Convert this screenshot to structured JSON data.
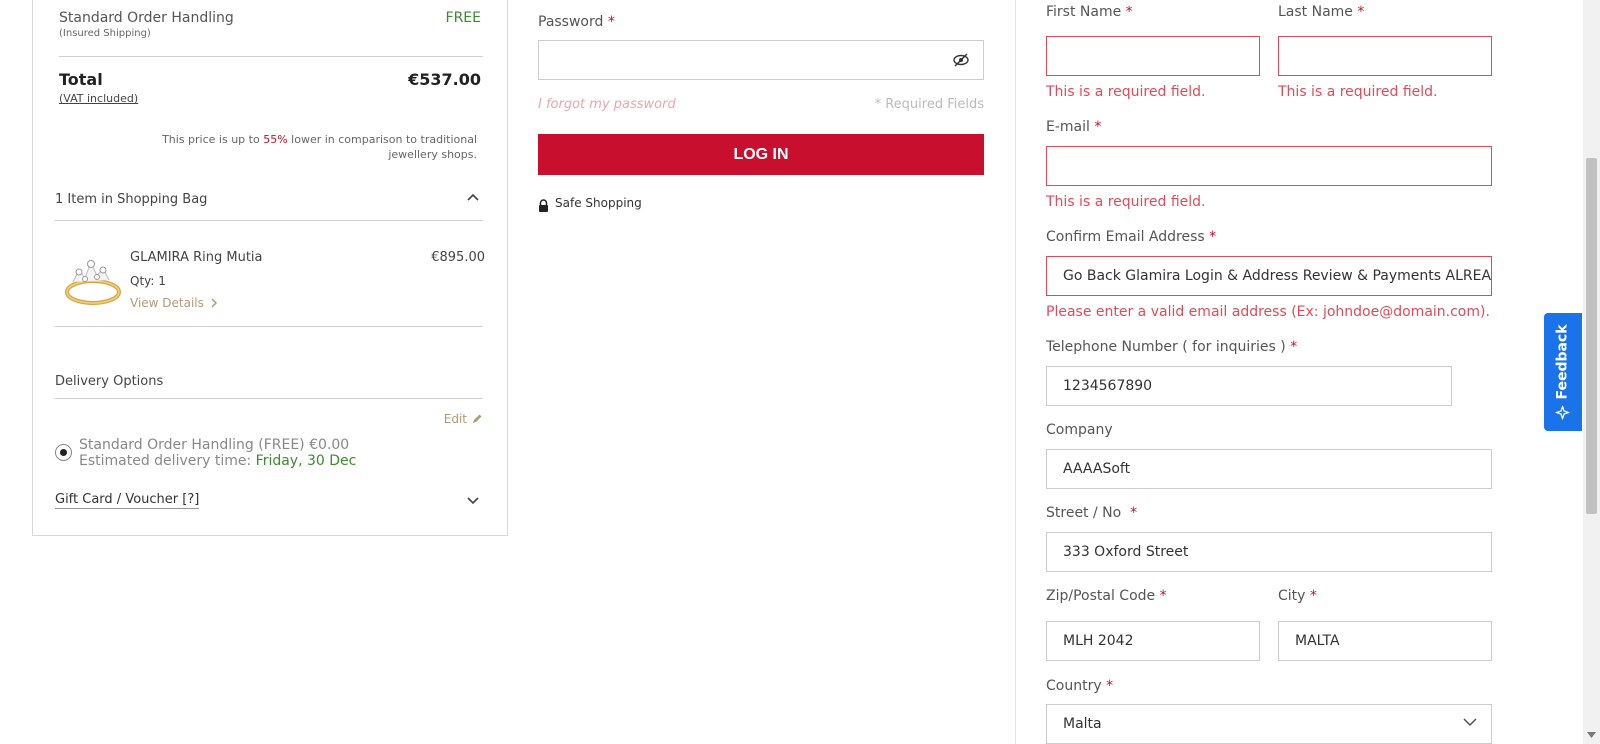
{
  "summary": {
    "handling_label": "Standard Order Handling",
    "handling_sub": "(Insured Shipping)",
    "handling_price": "FREE",
    "total_label": "Total",
    "total_value": "€537.00",
    "vat_label": "(VAT included)",
    "note_prefix": "This price is up to",
    "note_pct": "55%",
    "note_suffix": "lower in comparison to traditional jewellery shops.",
    "bag_title": "1 Item in Shopping Bag",
    "item": {
      "name": "GLAMIRA Ring Mutia",
      "price": "€895.00",
      "qty": "Qty: 1",
      "view_details": "View Details"
    },
    "delivery_title": "Delivery Options",
    "edit_label": "Edit",
    "option_line1": "Standard Order Handling (FREE) €0.00",
    "option_line2_prefix": "Estimated delivery time:",
    "option_date": "Friday, 30 Dec",
    "gift_label": "Gift Card / Voucher [?]"
  },
  "login": {
    "password_label": "Password",
    "password_value": "",
    "forgot_label": "I forgot my password",
    "required_fields": "* Required Fields",
    "login_button": "LOG IN",
    "safe_shopping": "Safe Shopping"
  },
  "form": {
    "first_name_label": "First Name",
    "first_name_value": "",
    "last_name_label": "Last Name",
    "last_name_value": "",
    "required_error": "This is a required field.",
    "email_label": "E-mail",
    "email_value": "",
    "confirm_email_label": "Confirm Email Address",
    "confirm_email_value": "Go Back Glamira Login & Address Review & Payments ALREADY",
    "confirm_email_error": "Please enter a valid email address (Ex: johndoe@domain.com).",
    "phone_label": "Telephone Number ( for inquiries )",
    "phone_value": "1234567890",
    "company_label": "Company",
    "company_value": "AAAASoft",
    "street_label": "Street / No",
    "street_value": "333 Oxford Street",
    "zip_label": "Zip/Postal Code",
    "zip_value": "MLH 2042",
    "city_label": "City",
    "city_value": "MALTA",
    "country_label": "Country",
    "country_value": "Malta"
  },
  "feedback_label": "Feedback",
  "required_mark": "*",
  "colors": {
    "brand_red": "#c8102e",
    "error_red": "#e04a5a",
    "success_green": "#3d8b2f",
    "link_gold": "#b39a76",
    "feedback_blue": "#1a73e8"
  }
}
